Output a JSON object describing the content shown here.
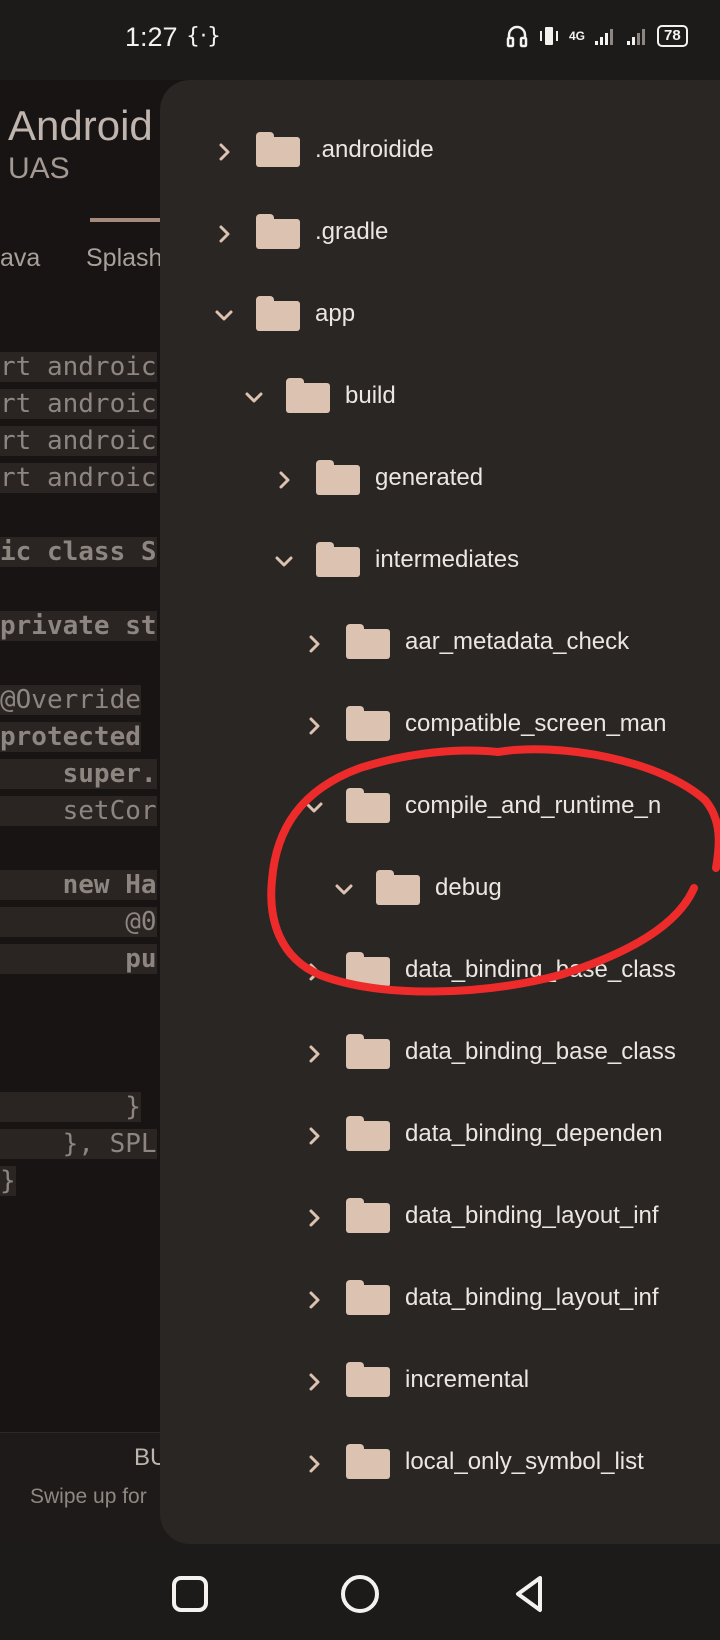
{
  "status_bar": {
    "time": "1:27",
    "battery": "78",
    "network": "4G"
  },
  "editor": {
    "title": "Android",
    "subtitle": "UAS",
    "tabs": [
      "ava",
      "Splash"
    ],
    "code_lines": [
      "rt androic",
      "rt androic",
      "rt androic",
      "rt androic",
      "ic class S",
      "private st",
      "@Override",
      "protected",
      "    super.",
      "    setCor",
      "    new Ha",
      "        @0",
      "        pu",
      "        }",
      "    }, SPL",
      "}"
    ],
    "build_label": "BU",
    "swipe_label": "Swipe up for"
  },
  "tree": {
    "items": [
      {
        "label": ".androidide",
        "depth": 0,
        "expanded": false
      },
      {
        "label": ".gradle",
        "depth": 0,
        "expanded": false
      },
      {
        "label": "app",
        "depth": 0,
        "expanded": true
      },
      {
        "label": "build",
        "depth": 1,
        "expanded": true
      },
      {
        "label": "generated",
        "depth": 2,
        "expanded": false
      },
      {
        "label": "intermediates",
        "depth": 2,
        "expanded": true
      },
      {
        "label": "aar_metadata_check",
        "depth": 3,
        "expanded": false
      },
      {
        "label": "compatible_screen_man",
        "depth": 3,
        "expanded": false
      },
      {
        "label": "compile_and_runtime_n",
        "depth": 3,
        "expanded": true
      },
      {
        "label": "debug",
        "depth": 4,
        "expanded": true
      },
      {
        "label": "data_binding_base_class",
        "depth": 3,
        "expanded": false
      },
      {
        "label": "data_binding_base_class",
        "depth": 3,
        "expanded": false
      },
      {
        "label": "data_binding_dependen",
        "depth": 3,
        "expanded": false
      },
      {
        "label": "data_binding_layout_inf",
        "depth": 3,
        "expanded": false
      },
      {
        "label": "data_binding_layout_inf",
        "depth": 3,
        "expanded": false
      },
      {
        "label": "incremental",
        "depth": 3,
        "expanded": false
      },
      {
        "label": "local_only_symbol_list",
        "depth": 3,
        "expanded": false
      }
    ]
  },
  "colors": {
    "folder": "#dcc2b0",
    "drawer_bg": "#2a2624",
    "annotation": "#ee2b2b"
  },
  "icons": [
    "chevron-right-icon",
    "chevron-down-icon",
    "folder-icon",
    "recents-square-icon",
    "home-circle-icon",
    "back-triangle-icon"
  ]
}
